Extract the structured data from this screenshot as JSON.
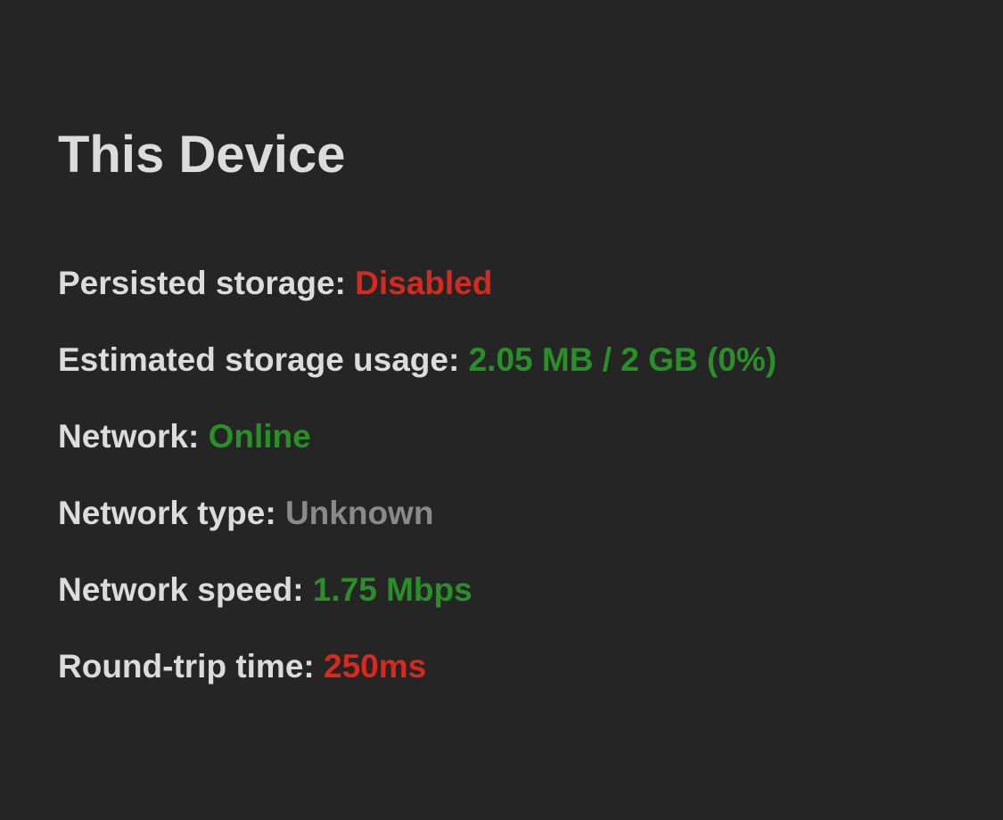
{
  "title": "This Device",
  "rows": {
    "persisted_storage": {
      "label": "Persisted storage: ",
      "value": "Disabled",
      "color": "red"
    },
    "estimated_storage": {
      "label": "Estimated storage usage: ",
      "value": "2.05 MB / 2 GB (0%)",
      "color": "green"
    },
    "network": {
      "label": "Network: ",
      "value": "Online",
      "color": "green"
    },
    "network_type": {
      "label": "Network type: ",
      "value": "Unknown",
      "color": "gray"
    },
    "network_speed": {
      "label": "Network speed: ",
      "value": "1.75 Mbps",
      "color": "green"
    },
    "rtt": {
      "label": "Round-trip time: ",
      "value": "250ms",
      "color": "red"
    }
  }
}
